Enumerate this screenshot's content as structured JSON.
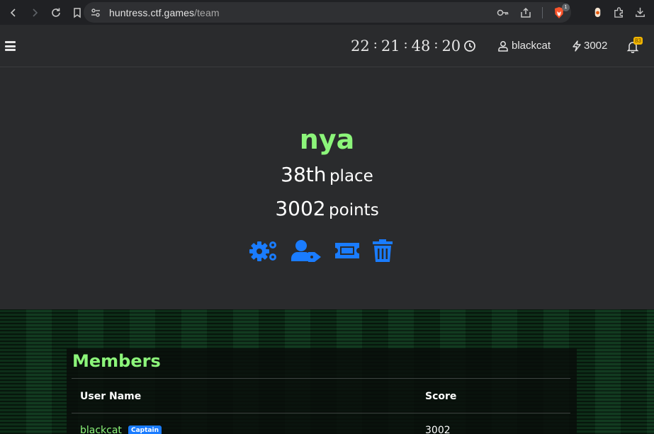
{
  "browser": {
    "url_host": "huntress.ctf.games",
    "url_path": "/team",
    "brave_shield_count": "1"
  },
  "header": {
    "timer": {
      "h": "22",
      "m": "21",
      "s": "48",
      "f": "20"
    },
    "username": "blackcat",
    "points": "3002",
    "notification_count": "83"
  },
  "team": {
    "name": "nya",
    "place_value": "38th",
    "place_label": "place",
    "points_value": "3002",
    "points_label": "points",
    "actions": [
      {
        "name": "settings-icon"
      },
      {
        "name": "user-tag-icon"
      },
      {
        "name": "ticket-icon"
      },
      {
        "name": "trash-icon"
      }
    ]
  },
  "members": {
    "title": "Members",
    "columns": [
      "User Name",
      "Score"
    ],
    "rows": [
      {
        "user": "blackcat",
        "badge": "Captain",
        "score": "3002"
      }
    ]
  },
  "colors": {
    "accent_green": "#8cf57a",
    "action_blue": "#1a7cff",
    "notification_yellow": "#f2b600"
  }
}
